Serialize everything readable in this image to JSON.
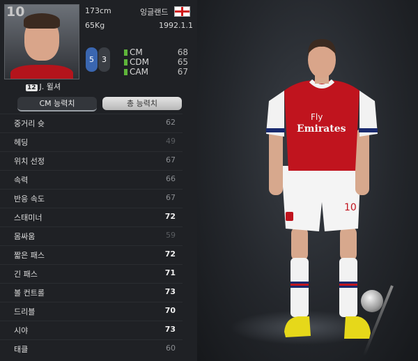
{
  "player": {
    "number": "10",
    "height": "173cm",
    "weight": "65Kg",
    "nationality": "잉글랜드",
    "birthdate": "1992.1.1",
    "name_badge": "12",
    "name": "J. 윌셔",
    "foot_left": "5",
    "foot_right": "3"
  },
  "positions": [
    {
      "name": "CM",
      "value": "68"
    },
    {
      "name": "CDM",
      "value": "65"
    },
    {
      "name": "CAM",
      "value": "67"
    }
  ],
  "tabs": {
    "active": "CM 능력치",
    "inactive": "총 능력치"
  },
  "stats": [
    {
      "name": "중거리 슛",
      "value": "62"
    },
    {
      "name": "헤딩",
      "value": "49"
    },
    {
      "name": "위치 선정",
      "value": "67"
    },
    {
      "name": "속력",
      "value": "66"
    },
    {
      "name": "반응 속도",
      "value": "67"
    },
    {
      "name": "스태미너",
      "value": "72"
    },
    {
      "name": "몸싸움",
      "value": "59"
    },
    {
      "name": "짧은 패스",
      "value": "72"
    },
    {
      "name": "긴 패스",
      "value": "71"
    },
    {
      "name": "볼 컨트롤",
      "value": "73"
    },
    {
      "name": "드리블",
      "value": "70"
    },
    {
      "name": "시야",
      "value": "73"
    },
    {
      "name": "태클",
      "value": "60"
    }
  ],
  "kit": {
    "sponsor_line1": "Fly",
    "sponsor_line2": "Emirates",
    "shorts_number": "10"
  },
  "colors": {
    "shirt_red": "#c0141e",
    "sleeve_white": "#f2f2f2",
    "boot_yellow": "#e6d81a",
    "stat_accent_green": "#5fb53a",
    "left_foot_blue": "#3a66b0"
  }
}
